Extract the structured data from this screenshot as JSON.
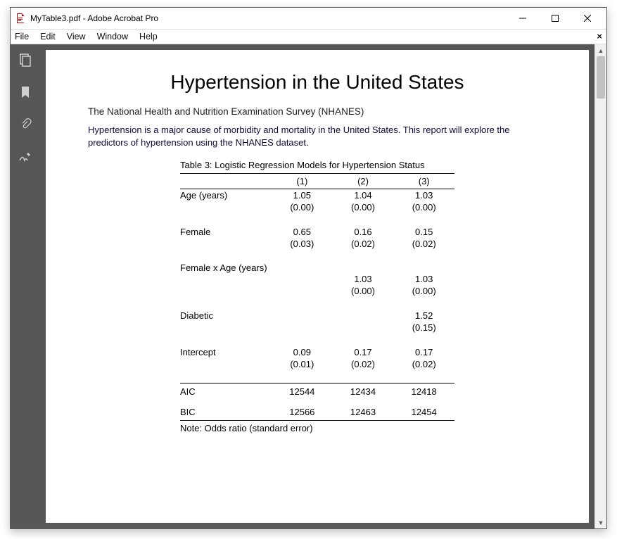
{
  "window": {
    "title": "MyTable3.pdf - Adobe Acrobat Pro"
  },
  "menu": {
    "items": [
      "File",
      "Edit",
      "View",
      "Window",
      "Help"
    ]
  },
  "doc": {
    "title": "Hypertension in the United States",
    "subtitle": "The National Health and Nutrition Examination Survey (NHANES)",
    "body": "Hypertension is a major cause of morbidity and mortality in the United States.  This report will explore the predictors of hypertension using the NHANES dataset."
  },
  "table": {
    "caption": "Table 3: Logistic Regression Models for Hypertension Status",
    "cols": [
      "(1)",
      "(2)",
      "(3)"
    ],
    "rows": [
      {
        "label": "Age (years)",
        "v": [
          "1.05",
          "1.04",
          "1.03"
        ],
        "se": [
          "(0.00)",
          "(0.00)",
          "(0.00)"
        ]
      },
      {
        "label": "Female",
        "v": [
          "0.65",
          "0.16",
          "0.15"
        ],
        "se": [
          "(0.03)",
          "(0.02)",
          "(0.02)"
        ]
      },
      {
        "label": "Female x Age (years)",
        "v": [
          "",
          "1.03",
          "1.03"
        ],
        "se": [
          "",
          "(0.00)",
          "(0.00)"
        ],
        "split": true
      },
      {
        "label": "Diabetic",
        "v": [
          "",
          "",
          "1.52"
        ],
        "se": [
          "",
          "",
          "(0.15)"
        ]
      },
      {
        "label": "Intercept",
        "v": [
          "0.09",
          "0.17",
          "0.17"
        ],
        "se": [
          "(0.01)",
          "(0.02)",
          "(0.02)"
        ]
      }
    ],
    "stats": [
      {
        "label": "AIC",
        "v": [
          "12544",
          "12434",
          "12418"
        ]
      },
      {
        "label": "BIC",
        "v": [
          "12566",
          "12463",
          "12454"
        ]
      }
    ],
    "note": "Note: Odds ratio (standard error)"
  }
}
